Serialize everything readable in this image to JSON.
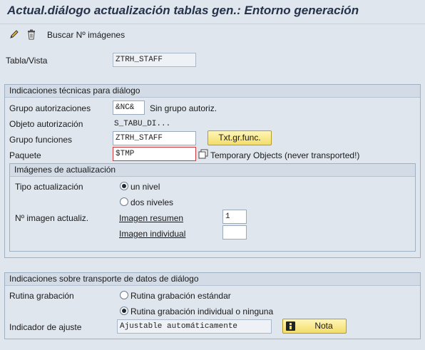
{
  "window": {
    "title": "Actual.diálogo actualización tablas gen.: Entorno generación"
  },
  "toolbar": {
    "edit_icon": "pencil-icon",
    "delete_icon": "trash-icon",
    "search_label": "Buscar Nº imágenes"
  },
  "table": {
    "label": "Tabla/Vista",
    "value": "ZTRH_STAFF"
  },
  "tech": {
    "header": "Indicaciones técnicas para diálogo",
    "auth_group_label": "Grupo autorizaciones",
    "auth_group_value": "&NC&",
    "auth_group_desc": "Sin grupo autoriz.",
    "auth_object_label": "Objeto autorización",
    "auth_object_value": "S_TABU_DI...",
    "function_group_label": "Grupo funciones",
    "function_group_value": "ZTRH_STAFF",
    "function_group_button": "Txt.gr.func.",
    "package_label": "Paquete",
    "package_value": "$TMP",
    "package_desc": "Temporary Objects (never transported!)"
  },
  "screens": {
    "header": "Imágenes de actualización",
    "type_label": "Tipo actualización",
    "option_one": "un nivel",
    "option_two": "dos niveles",
    "screen_number_label": "Nº imagen actualiz.",
    "overview_label": "Imagen resumen",
    "overview_value": "1",
    "single_label": "Imagen individual",
    "single_value": ""
  },
  "transport": {
    "header": "Indicaciones sobre transporte de datos de diálogo",
    "routine_label": "Rutina grabación",
    "routine_standard": "Rutina grabación estándar",
    "routine_individual": "Rutina grabación individual o ninguna",
    "adjust_label": "Indicador de ajuste",
    "adjust_value": "Ajustable automáticamente",
    "note_button": "Nota"
  },
  "colors": {
    "background": "#dfe6ee",
    "button": "#f3dd6a",
    "required": "#d13a3a"
  }
}
